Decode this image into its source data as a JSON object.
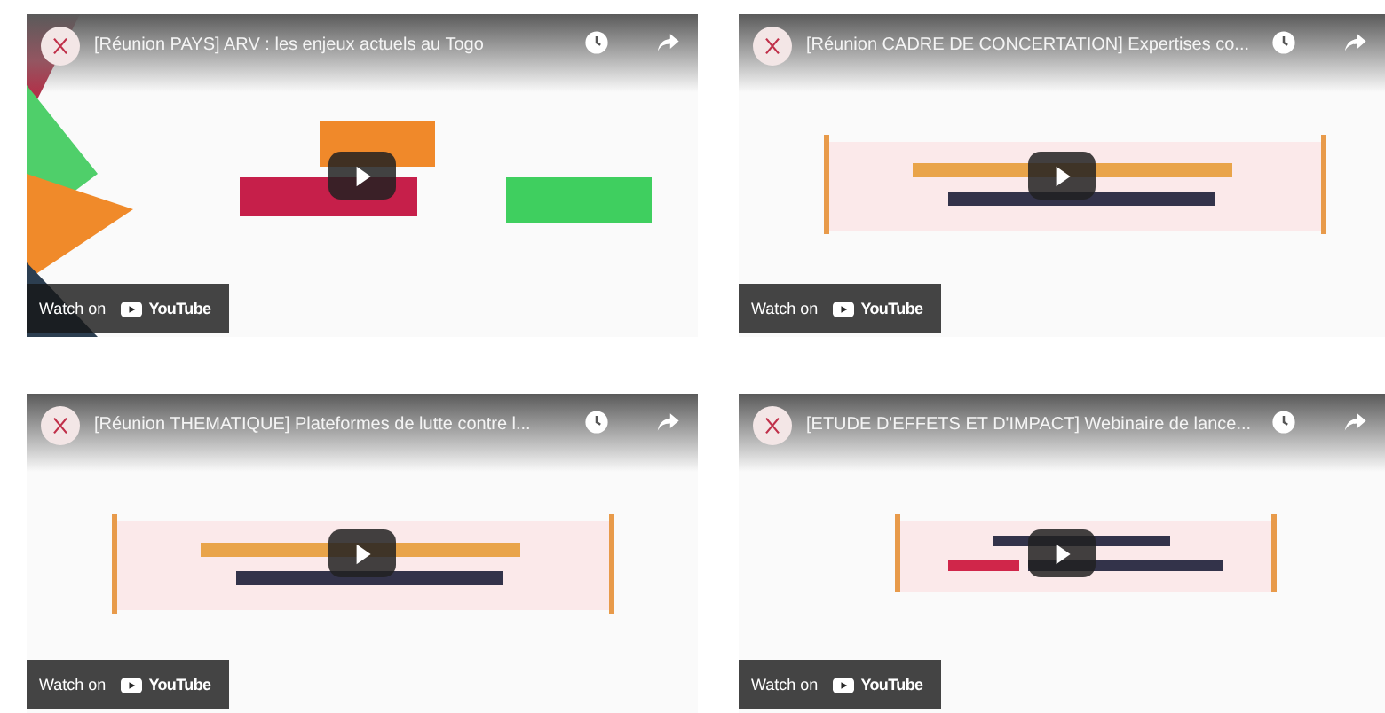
{
  "videos": [
    {
      "title": "[Réunion PAYS] ARV : les enjeux actuels au Togo",
      "watch_on": "Watch on",
      "logo_text": "YouTube"
    },
    {
      "title": "[Réunion CADRE DE CONCERTATION] Expertises co...",
      "watch_on": "Watch on",
      "logo_text": "YouTube"
    },
    {
      "title": "[Réunion THEMATIQUE] Plateformes de lutte contre l...",
      "watch_on": "Watch on",
      "logo_text": "YouTube"
    },
    {
      "title": "[ETUDE D'EFFETS ET D'IMPACT] Webinaire de lance...",
      "watch_on": "Watch on",
      "logo_text": "YouTube"
    }
  ]
}
